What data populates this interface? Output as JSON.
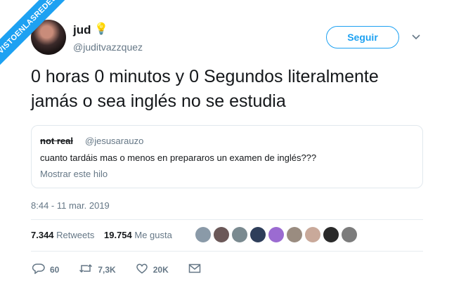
{
  "watermark": "VISTOENLASREDES",
  "author": {
    "name": "jud",
    "handle": "@juditvazzquez"
  },
  "follow_label": "Seguir",
  "tweet_text": "0 horas 0 minutos y 0 Segundos literalmente jamás o sea inglés no se estudia",
  "quote": {
    "name": "not real",
    "handle": "@jesusarauzo",
    "text": "cuanto tardáis mas o menos en prepararos un examen de inglés???",
    "link": "Mostrar este hilo"
  },
  "timestamp": "8:44 - 11 mar. 2019",
  "stats": {
    "retweets_count": "7.344",
    "retweets_label": "Retweets",
    "likes_count": "19.754",
    "likes_label": "Me gusta"
  },
  "actions": {
    "replies": "60",
    "retweets": "7,3K",
    "likes": "20K"
  },
  "colors": {
    "accent": "#1da1f2",
    "text": "#14171a",
    "muted": "#657786",
    "border": "#e1e8ed"
  },
  "icons": [
    "lightbulb-icon",
    "chevron-down-icon",
    "reply-icon",
    "retweet-icon",
    "heart-icon",
    "mail-icon"
  ]
}
